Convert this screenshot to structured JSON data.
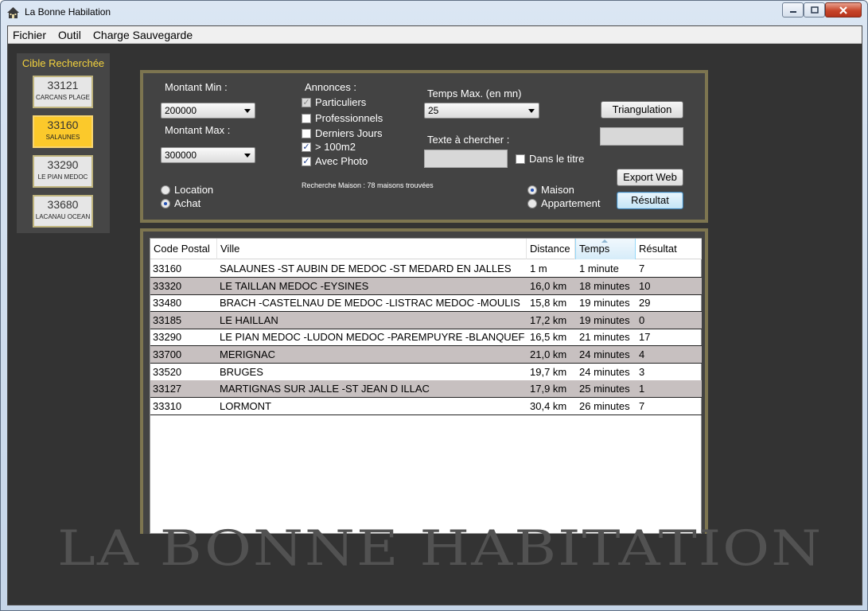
{
  "window": {
    "title": "La Bonne Habilation",
    "controls": {
      "minimize": "minimize-icon",
      "maximize": "maximize-icon",
      "close": "close-icon"
    }
  },
  "menu": [
    "Fichier",
    "Outil",
    "Charge Sauvegarde"
  ],
  "cible": {
    "title": "Cible Recherchée",
    "items": [
      {
        "code": "33121",
        "city": "CARCANS PLAGE",
        "active": false
      },
      {
        "code": "33160",
        "city": "SALAUNES",
        "active": true
      },
      {
        "code": "33290",
        "city": "LE PIAN MEDOC",
        "active": false
      },
      {
        "code": "33680",
        "city": "LACANAU OCEAN",
        "active": false
      }
    ]
  },
  "form": {
    "montant_min_label": "Montant Min :",
    "montant_min_value": "200000",
    "montant_max_label": "Montant Max :",
    "montant_max_value": "300000",
    "annonces_label": "Annonces :",
    "checks": {
      "particuliers": "Particuliers",
      "professionnels": "Professionnels",
      "derniers_jours": "Derniers Jours",
      "surface": "> 100m2",
      "avec_photo": "Avec Photo",
      "dans_le_titre": "Dans le titre"
    },
    "temps_label": "Temps Max. (en mn)",
    "temps_value": "25",
    "texte_label": "Texte à chercher :",
    "location": "Location",
    "achat": "Achat",
    "status": "Recherche Maison : 78 maisons trouvées",
    "maison": "Maison",
    "appartement": "Appartement",
    "triangulation": "Triangulation",
    "export_web": "Export Web",
    "resultat": "Résultat"
  },
  "table": {
    "headers": [
      "Code Postal",
      "Ville",
      "Distance",
      "Temps",
      "Résultat"
    ],
    "rows": [
      [
        "33160",
        "SALAUNES  -ST AUBIN DE MEDOC  -ST MEDARD EN JALLES",
        "1 m",
        "1 minute",
        "7"
      ],
      [
        "33320",
        "LE TAILLAN MEDOC  -EYSINES",
        "16,0 km",
        "18 minutes",
        "10"
      ],
      [
        "33480",
        "BRACH  -CASTELNAU DE MEDOC  -LISTRAC MEDOC  -MOULIS",
        "15,8 km",
        "19 minutes",
        "29"
      ],
      [
        "33185",
        "LE HAILLAN",
        "17,2 km",
        "19 minutes",
        "0"
      ],
      [
        "33290",
        "LE PIAN MEDOC  -LUDON MEDOC  -PAREMPUYRE  -BLANQUEFORT",
        "16,5 km",
        "21 minutes",
        "17"
      ],
      [
        "33700",
        "MERIGNAC",
        "21,0 km",
        "24 minutes",
        "4"
      ],
      [
        "33520",
        "BRUGES",
        "19,7 km",
        "24 minutes",
        "3"
      ],
      [
        "33127",
        "MARTIGNAS SUR JALLE  -ST JEAN D ILLAC",
        "17,9 km",
        "25 minutes",
        "1"
      ],
      [
        "33310",
        "LORMONT",
        "30,4 km",
        "26 minutes",
        "7"
      ]
    ]
  },
  "watermark": "LA BONNE HABITATION"
}
